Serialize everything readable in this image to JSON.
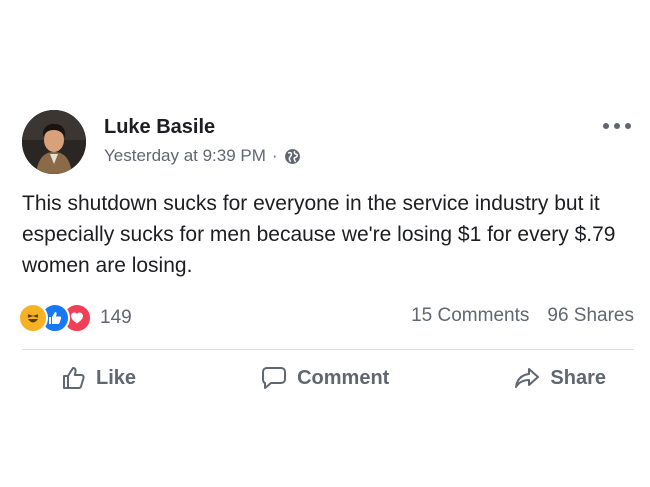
{
  "post": {
    "author": "Luke Basile",
    "timestamp": "Yesterday at 9:39 PM",
    "separator": "·",
    "privacy_icon": "globe-icon",
    "text": "This shutdown sucks for everyone in the service industry but it especially sucks for men because we're losing $1 for every $.79 women are losing."
  },
  "stats": {
    "reaction_icons": [
      "haha-icon",
      "like-icon",
      "love-icon"
    ],
    "reaction_count": "149",
    "comments": "15 Comments",
    "shares": "96 Shares"
  },
  "actions": {
    "like_label": "Like",
    "comment_label": "Comment",
    "share_label": "Share"
  },
  "colors": {
    "text": "#1c1e21",
    "secondary": "#616770",
    "like_blue": "#1877f2",
    "love_red": "#f33e58",
    "haha_yellow": "#f7b125"
  }
}
